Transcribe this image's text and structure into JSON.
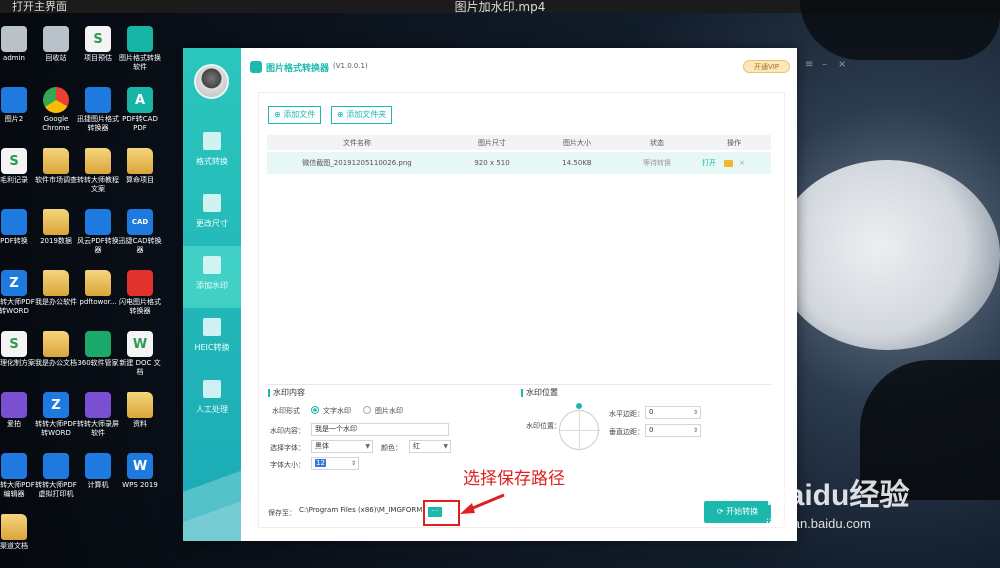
{
  "player": {
    "left_label": "打开主界面",
    "title": "图片加水印.mp4"
  },
  "desktop": {
    "icons": [
      {
        "label": "admin",
        "icon": "user-folder-icon"
      },
      {
        "label": "回收站",
        "icon": "recycle-bin-icon"
      },
      {
        "label": "项目预估",
        "icon": "spreadsheet-icon"
      },
      {
        "label": "图片格式转换软件",
        "icon": "image-converter-icon"
      },
      {
        "label": "图片2",
        "icon": "image-file-icon"
      },
      {
        "label": "Google Chrome",
        "icon": "chrome-icon"
      },
      {
        "label": "迅捷图片格式转换器",
        "icon": "converter-icon"
      },
      {
        "label": "PDF转CAD PDF",
        "icon": "pdf-cad-icon"
      },
      {
        "label": "毛利记录",
        "icon": "spreadsheet-icon"
      },
      {
        "label": "软件市场调查",
        "icon": "document-icon"
      },
      {
        "label": "转转大师教程文案",
        "icon": "folder-icon"
      },
      {
        "label": "算命项目",
        "icon": "folder-icon"
      },
      {
        "label": "PDF转换",
        "icon": "pdf-icon"
      },
      {
        "label": "2019数据",
        "icon": "folder-icon"
      },
      {
        "label": "风云PDF转换器",
        "icon": "pdf-converter-icon"
      },
      {
        "label": "迅捷CAD转换器",
        "icon": "cad-icon"
      },
      {
        "label": "转转大师PDF转WORD",
        "icon": "pdf-word-icon"
      },
      {
        "label": "我是办公软件",
        "icon": "document-icon"
      },
      {
        "label": "pdftowor...",
        "icon": "folder-icon"
      },
      {
        "label": "闪电图片格式转换器",
        "icon": "lightning-converter-icon"
      },
      {
        "label": "合理化制方案",
        "icon": "spreadsheet-icon"
      },
      {
        "label": "我是办公文档",
        "icon": "document-icon"
      },
      {
        "label": "360软件管家",
        "icon": "software-manager-icon"
      },
      {
        "label": "新建 DOC 文档",
        "icon": "doc-icon"
      },
      {
        "label": "爱拍",
        "icon": "camera-app-icon"
      },
      {
        "label": "转转大师PDF转WORD",
        "icon": "pdf-word-icon"
      },
      {
        "label": "转转大师录屏软件",
        "icon": "screen-recorder-icon"
      },
      {
        "label": "资料",
        "icon": "folder-icon"
      },
      {
        "label": "转转大师PDF编辑器",
        "icon": "pdf-editor-icon"
      },
      {
        "label": "转转大师PDF虚拟打印机",
        "icon": "pdf-printer-icon"
      },
      {
        "label": "计算机",
        "icon": "computer-icon"
      },
      {
        "label": "WPS 2019",
        "icon": "wps-icon"
      },
      {
        "label": "渠道文档",
        "icon": "folder-icon"
      }
    ]
  },
  "app": {
    "title": "图片格式转换器",
    "version": "(V1.0.0.1)",
    "vip_label": "开通VIP",
    "sidebar": [
      {
        "label": "格式转换"
      },
      {
        "label": "更改尺寸"
      },
      {
        "label": "添加水印"
      },
      {
        "label": "HEIC转换"
      },
      {
        "label": "人工处理"
      }
    ],
    "toolbar": {
      "add_file": "添加文件",
      "add_folder": "添加文件夹"
    },
    "table": {
      "headers": [
        "文件名称",
        "图片尺寸",
        "图片大小",
        "状态",
        "操作"
      ],
      "rows": [
        {
          "name": "微信截图_20191205110026.png",
          "size": "920 x 510",
          "filesize": "14.50KB",
          "status": "等待转换",
          "action": "打开"
        }
      ]
    },
    "watermark": {
      "section_title": "水印内容",
      "form_label": "水印形式",
      "text_option": "文字水印",
      "image_option": "图片水印",
      "content_label": "水印内容：",
      "content_value": "我是一个水印",
      "font_label": "选择字体：",
      "font_value": "黑体",
      "color_label": "颜色：",
      "color_value": "红",
      "size_label": "字体大小：",
      "size_value": "12"
    },
    "position": {
      "section_title": "水印位置",
      "pos_label": "水印位置：",
      "h_margin_label": "水平边距：",
      "h_margin_value": "0",
      "v_margin_label": "垂直边距：",
      "v_margin_value": "0"
    },
    "save": {
      "label": "保存至：",
      "path": "C:\\Program Files (x86)\\M_IMGFORM",
      "browse": "···",
      "start": "开始转换"
    }
  },
  "annotation": {
    "text": "选择保存路径"
  },
  "watermark_brand": {
    "logo": "Baidu经验",
    "url": "jingyan.baidu.com"
  },
  "colors": {
    "accent": "#1bb8ad",
    "annotation": "#e02020"
  }
}
